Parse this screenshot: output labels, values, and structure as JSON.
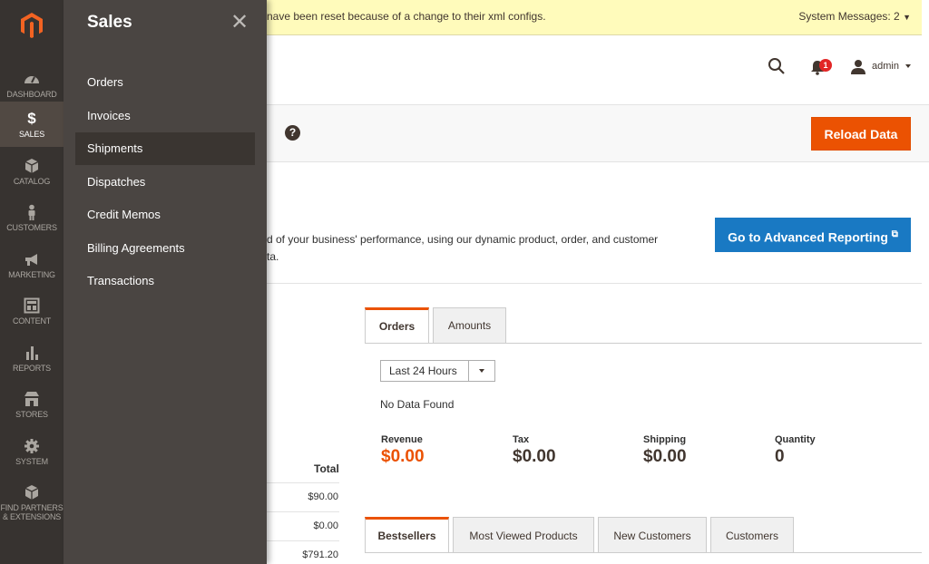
{
  "nav": {
    "items": [
      {
        "label": "DASHBOARD",
        "icon": "dashboard-icon"
      },
      {
        "label": "SALES",
        "icon": "dollar-icon"
      },
      {
        "label": "CATALOG",
        "icon": "cube-icon"
      },
      {
        "label": "CUSTOMERS",
        "icon": "person-icon"
      },
      {
        "label": "MARKETING",
        "icon": "megaphone-icon"
      },
      {
        "label": "CONTENT",
        "icon": "layout-icon"
      },
      {
        "label": "REPORTS",
        "icon": "bar-chart-icon"
      },
      {
        "label": "STORES",
        "icon": "store-icon"
      },
      {
        "label": "SYSTEM",
        "icon": "gear-icon"
      },
      {
        "label_line1": "FIND PARTNERS",
        "label_line2": "& EXTENSIONS",
        "icon": "box-icon"
      }
    ]
  },
  "flyout": {
    "title": "Sales",
    "close": "✕",
    "items": [
      {
        "label": "Orders"
      },
      {
        "label": "Invoices"
      },
      {
        "label": "Shipments"
      },
      {
        "label": "Dispatches"
      },
      {
        "label": "Credit Memos"
      },
      {
        "label": "Billing Agreements"
      },
      {
        "label": "Transactions"
      }
    ]
  },
  "message_bar": {
    "text": "nave been reset because of a change to their xml configs.",
    "system_messages": "System Messages: 2"
  },
  "header": {
    "notification_count": "1",
    "user": "admin"
  },
  "actions": {
    "help": "?",
    "reload": "Reload Data"
  },
  "advanced": {
    "line1": "d of your business' performance, using our dynamic product, order, and customer",
    "line2": "ta.",
    "button": "Go to Advanced Reporting",
    "button_icon": "⧉"
  },
  "orders_tabs": [
    {
      "label": "Orders"
    },
    {
      "label": "Amounts"
    }
  ],
  "period": {
    "selected": "Last 24 Hours"
  },
  "no_data": "No Data Found",
  "metrics": [
    {
      "label": "Revenue",
      "value": "$0.00"
    },
    {
      "label": "Tax",
      "value": "$0.00"
    },
    {
      "label": "Shipping",
      "value": "$0.00"
    },
    {
      "label": "Quantity",
      "value": "0"
    }
  ],
  "last_orders": {
    "header": "Total",
    "values": [
      "$90.00",
      "$0.00",
      "$791.20"
    ]
  },
  "bottom_tabs": [
    {
      "label": "Bestsellers"
    },
    {
      "label": "Most Viewed Products"
    },
    {
      "label": "New Customers"
    },
    {
      "label": "Customers"
    }
  ],
  "colors": {
    "brand_orange": "#eb5202",
    "brand_blue": "#1979c3",
    "nav_bg": "#373330"
  }
}
